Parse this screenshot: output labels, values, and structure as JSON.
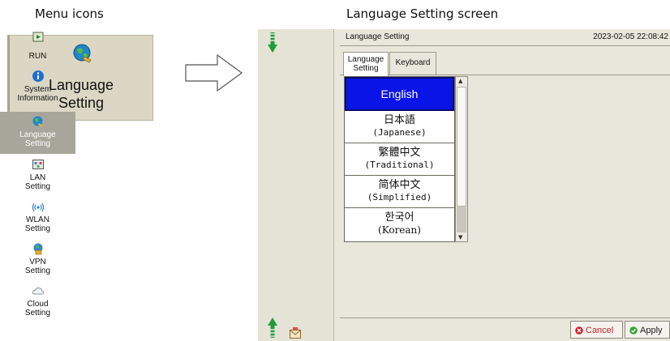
{
  "captions": {
    "left": "Menu icons",
    "right": "Language Setting screen"
  },
  "menu_icon": {
    "label_line1": "Language",
    "label_line2": "Setting",
    "icon": "globe-icon"
  },
  "screen": {
    "title": "Language Setting",
    "datetime": "2023-02-05 22:08:42",
    "tabs": [
      {
        "label_line1": "Language",
        "label_line2": "Setting",
        "active": true
      },
      {
        "label": "Keyboard",
        "active": false
      }
    ],
    "sidebar": [
      {
        "label": "RUN",
        "icon": "run-icon"
      },
      {
        "label_line1": "System",
        "label_line2": "Information",
        "icon": "info-icon"
      },
      {
        "label_line1": "Language",
        "label_line2": "Setting",
        "icon": "globe-icon",
        "active": true
      },
      {
        "label_line1": "LAN",
        "label_line2": "Setting",
        "icon": "lan-icon"
      },
      {
        "label_line1": "WLAN",
        "label_line2": "Setting",
        "icon": "wifi-icon"
      },
      {
        "label_line1": "VPN",
        "label_line2": "Setting",
        "icon": "vpn-icon"
      },
      {
        "label_line1": "Cloud",
        "label_line2": "Setting",
        "icon": "cloud-icon"
      }
    ],
    "languages": [
      {
        "line1": "English",
        "selected": true
      },
      {
        "line1": "日本語",
        "line2": "(Japanese)"
      },
      {
        "line1": "繁體中文",
        "line2": "(Traditional)"
      },
      {
        "line1": "简体中文",
        "line2": "(Simplified)"
      },
      {
        "line1": "한국어",
        "line2": "(Korean)"
      }
    ],
    "buttons": {
      "cancel": "Cancel",
      "apply": "Apply"
    }
  },
  "colors": {
    "selected_bg": "#0a14e6",
    "active_sidebar_bg": "#a8a69a",
    "panel_bg": "#e9e7dc",
    "cancel_text": "#d4202a"
  }
}
